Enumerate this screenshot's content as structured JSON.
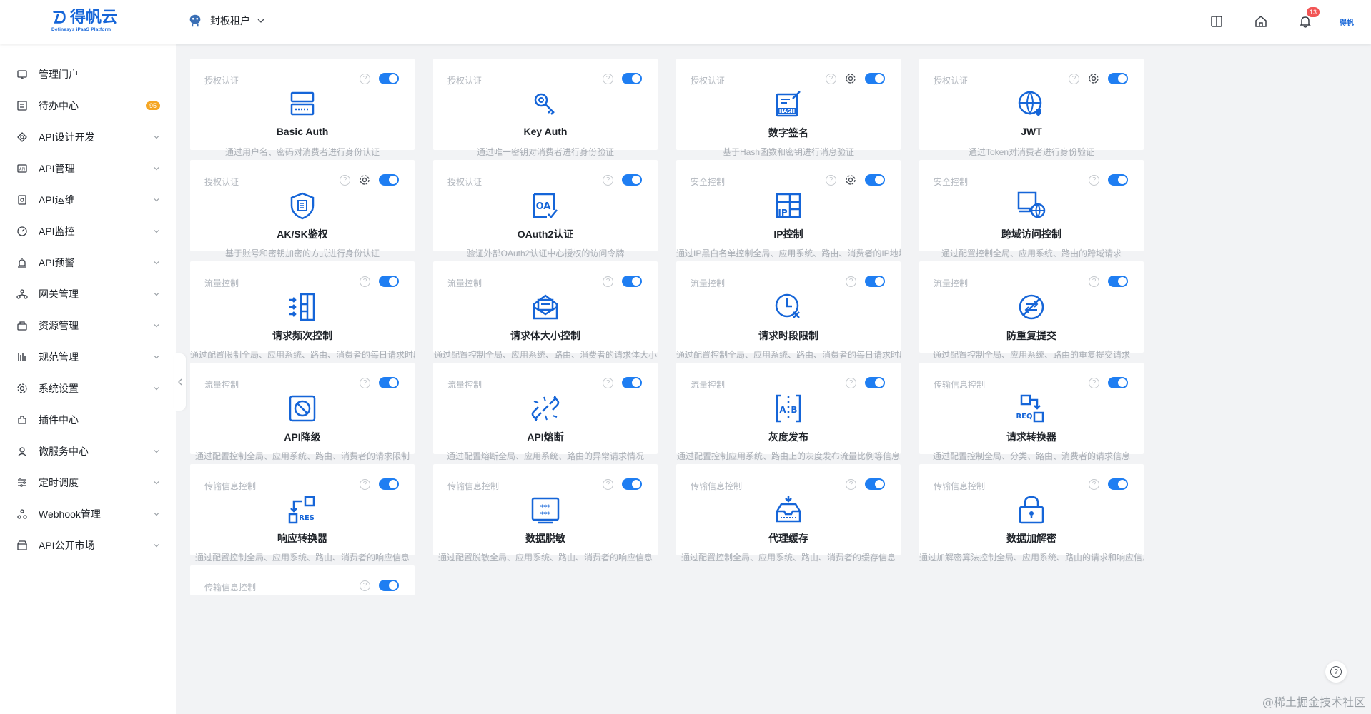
{
  "header": {
    "logo_text": "得帆云",
    "logo_sub": "Definesys iPaaS Platform",
    "tenant": "封板租户",
    "notification_count": "13",
    "user_brand": "得帆"
  },
  "sidebar": {
    "items": [
      {
        "label": "管理门户",
        "icon": "portal-icon",
        "expandable": false
      },
      {
        "label": "待办中心",
        "icon": "todo-icon",
        "expandable": false,
        "badge": "95"
      },
      {
        "label": "API设计开发",
        "icon": "api-design-icon",
        "expandable": true
      },
      {
        "label": "API管理",
        "icon": "api-manage-icon",
        "expandable": true
      },
      {
        "label": "API运维",
        "icon": "api-ops-icon",
        "expandable": true
      },
      {
        "label": "API监控",
        "icon": "monitor-icon",
        "expandable": true
      },
      {
        "label": "API预警",
        "icon": "alarm-icon",
        "expandable": true
      },
      {
        "label": "网关管理",
        "icon": "gateway-icon",
        "expandable": true
      },
      {
        "label": "资源管理",
        "icon": "resource-icon",
        "expandable": true
      },
      {
        "label": "规范管理",
        "icon": "spec-icon",
        "expandable": true
      },
      {
        "label": "系统设置",
        "icon": "settings-icon",
        "expandable": true
      },
      {
        "label": "插件中心",
        "icon": "plugin-icon",
        "expandable": false
      },
      {
        "label": "微服务中心",
        "icon": "microservice-icon",
        "expandable": true
      },
      {
        "label": "定时调度",
        "icon": "schedule-icon",
        "expandable": true
      },
      {
        "label": "Webhook管理",
        "icon": "webhook-icon",
        "expandable": true
      },
      {
        "label": "API公开市场",
        "icon": "market-icon",
        "expandable": true
      }
    ]
  },
  "plugins": [
    {
      "category": "授权认证",
      "title": "Basic Auth",
      "desc": "通过用户名、密码对消费者进行身份认证",
      "icon": "server-icon",
      "gear": false
    },
    {
      "category": "授权认证",
      "title": "Key Auth",
      "desc": "通过唯一密钥对消费者进行身份验证",
      "icon": "key-icon",
      "gear": false
    },
    {
      "category": "授权认证",
      "title": "数字签名",
      "desc": "基于Hash函数和密钥进行消息验证",
      "icon": "hash-sign-icon",
      "gear": true
    },
    {
      "category": "授权认证",
      "title": "JWT",
      "desc": "通过Token对消费者进行身份验证",
      "icon": "globe-shield-icon",
      "gear": true
    },
    {
      "category": "授权认证",
      "title": "AK/SK鉴权",
      "desc": "基于账号和密钥加密的方式进行身份认证",
      "icon": "shield-icon",
      "gear": true
    },
    {
      "category": "授权认证",
      "title": "OAuth2认证",
      "desc": "验证外部OAuth2认证中心授权的访问令牌",
      "icon": "oauth-icon",
      "gear": false
    },
    {
      "category": "安全控制",
      "title": "IP控制",
      "desc": "通过IP黑白名单控制全局、应用系统、路由、消费者的IP地址",
      "icon": "ip-icon",
      "gear": true
    },
    {
      "category": "安全控制",
      "title": "跨域访问控制",
      "desc": "通过配置控制全局、应用系统、路由的跨域请求",
      "icon": "cors-icon",
      "gear": false
    },
    {
      "category": "流量控制",
      "title": "请求频次控制",
      "desc": "通过配置限制全局、应用系统、路由、消费者的每日请求时段",
      "icon": "rate-limit-icon",
      "gear": false
    },
    {
      "category": "流量控制",
      "title": "请求体大小控制",
      "desc": "通过配置控制全局、应用系统、路由、消费者的请求体大小",
      "icon": "mail-size-icon",
      "gear": false
    },
    {
      "category": "流量控制",
      "title": "请求时段限制",
      "desc": "通过配置控制全局、应用系统、路由、消费者的每日请求时段",
      "icon": "clock-limit-icon",
      "gear": false
    },
    {
      "category": "流量控制",
      "title": "防重复提交",
      "desc": "通过配置控制全局、应用系统、路由的重复提交请求",
      "icon": "no-repeat-icon",
      "gear": false
    },
    {
      "category": "流量控制",
      "title": "API降级",
      "desc": "通过配置控制全局、应用系统、路由、消费者的请求限制",
      "icon": "block-icon",
      "gear": false
    },
    {
      "category": "流量控制",
      "title": "API熔断",
      "desc": "通过配置熔断全局、应用系统、路由的异常请求情况",
      "icon": "broken-link-icon",
      "gear": false
    },
    {
      "category": "流量控制",
      "title": "灰度发布",
      "desc": "通过配置控制应用系统、路由上的灰度发布流量比例等信息",
      "icon": "ab-test-icon",
      "gear": false
    },
    {
      "category": "传输信息控制",
      "title": "请求转换器",
      "desc": "通过配置控制全局、分类、路由、消费者的请求信息",
      "icon": "req-transform-icon",
      "gear": false
    },
    {
      "category": "传输信息控制",
      "title": "响应转换器",
      "desc": "通过配置控制全局、应用系统、路由、消费者的响应信息",
      "icon": "res-transform-icon",
      "gear": false
    },
    {
      "category": "传输信息控制",
      "title": "数据脱敏",
      "desc": "通过配置脱敏全局、应用系统、路由、消费者的响应信息",
      "icon": "mask-icon",
      "gear": false
    },
    {
      "category": "传输信息控制",
      "title": "代理缓存",
      "desc": "通过配置控制全局、应用系统、路由、消费者的缓存信息",
      "icon": "cache-icon",
      "gear": false
    },
    {
      "category": "传输信息控制",
      "title": "数据加解密",
      "desc": "通过加解密算法控制全局、应用系统、路由的请求和响应信息",
      "icon": "lock-icon",
      "gear": false
    },
    {
      "category": "传输信息控制",
      "title": "",
      "desc": "",
      "icon": "",
      "gear": false
    }
  ],
  "watermark": "@稀土掘金技术社区",
  "colors": {
    "accent": "#1565d8",
    "toggle": "#1f7ef2",
    "badge_orange": "#f5a623",
    "badge_red": "#f25555"
  }
}
